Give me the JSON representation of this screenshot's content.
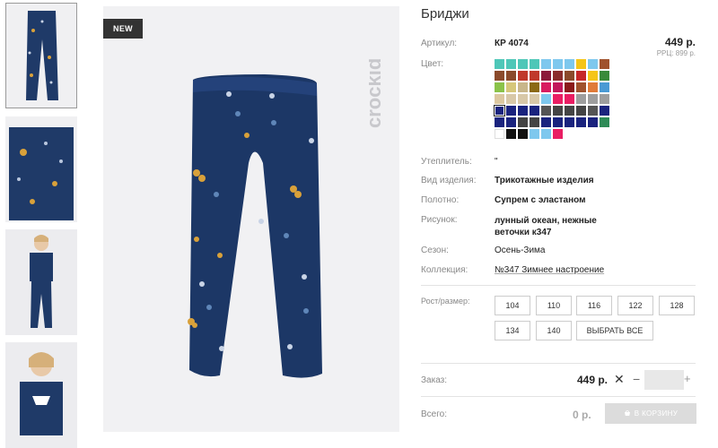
{
  "product": {
    "title": "Бриджи",
    "badge": "NEW",
    "brand": "crockid",
    "price": "449 р.",
    "rrp": "РРЦ: 899 р."
  },
  "specs": {
    "article": {
      "label": "Артикул:",
      "value": "КР 4074"
    },
    "color": {
      "label": "Цвет:"
    },
    "insulation": {
      "label": "Утеплитель:",
      "value": "\""
    },
    "type": {
      "label": "Вид изделия:",
      "value": "Трикотажные изделия"
    },
    "fabric": {
      "label": "Полотно:",
      "value": "Супрем с эластаном"
    },
    "pattern": {
      "label": "Рисунок:",
      "value": "лунный океан, нежные веточки к347"
    },
    "season": {
      "label": "Сезон:",
      "value": "Осень-Зима"
    },
    "collection": {
      "label": "Коллекция:",
      "value": "№347 Зимнее настроение"
    }
  },
  "swatches": [
    "#4ec7b8",
    "#4ec7b8",
    "#4ec7b8",
    "#4ec7b8",
    "#7ec8ee",
    "#7ec8ee",
    "#7ec8ee",
    "#f5c518",
    "#7ec8ee",
    "#a0522d",
    "#8b4a2b",
    "#8b4a2b",
    "#c0392b",
    "#c0392b",
    "#8b1a3a",
    "#8b2d2d",
    "#8b4a2b",
    "#c62828",
    "#f5c518",
    "#3a8a3a",
    "#8bc34a",
    "#d6c77a",
    "#c8b68a",
    "#8b6914",
    "#d81b60",
    "#c2185b",
    "#8b1a1a",
    "#a0522d",
    "#e07b39",
    "#4a9ad4",
    "#dcc8a0",
    "#d8c8a8",
    "#d8c8a8",
    "#d8c8a8",
    "#7ec8ee",
    "#e91e63",
    "#e91e63",
    "#9e9e9e",
    "#9e9e9e",
    "#9e9e9e",
    "#1a237e",
    "#1a237e",
    "#1a237e",
    "#1a237e",
    "#555555",
    "#444444",
    "#444444",
    "#444444",
    "#555555",
    "#1a237e",
    "#1a237e",
    "#1a237e",
    "#444444",
    "#444444",
    "#1a237e",
    "#1a237e",
    "#1a237e",
    "#1a237e",
    "#1a237e",
    "#2e8b57",
    "#ffffff",
    "#111111",
    "#111111",
    "#7ec8ee",
    "#7ec8ee",
    "#e91e63"
  ],
  "selected_swatch_index": 40,
  "sizes": {
    "label": "Рост/размер:",
    "options": [
      "104",
      "110",
      "116",
      "122",
      "128",
      "134",
      "140"
    ],
    "select_all": "ВЫБРАТЬ ВСЕ"
  },
  "order": {
    "label": "Заказ:",
    "price": "449 р.",
    "minus": "−",
    "plus": "+",
    "qty": ""
  },
  "total": {
    "label": "Всего:",
    "value": "0 р.",
    "cart_button": "В КОРЗИНУ"
  }
}
